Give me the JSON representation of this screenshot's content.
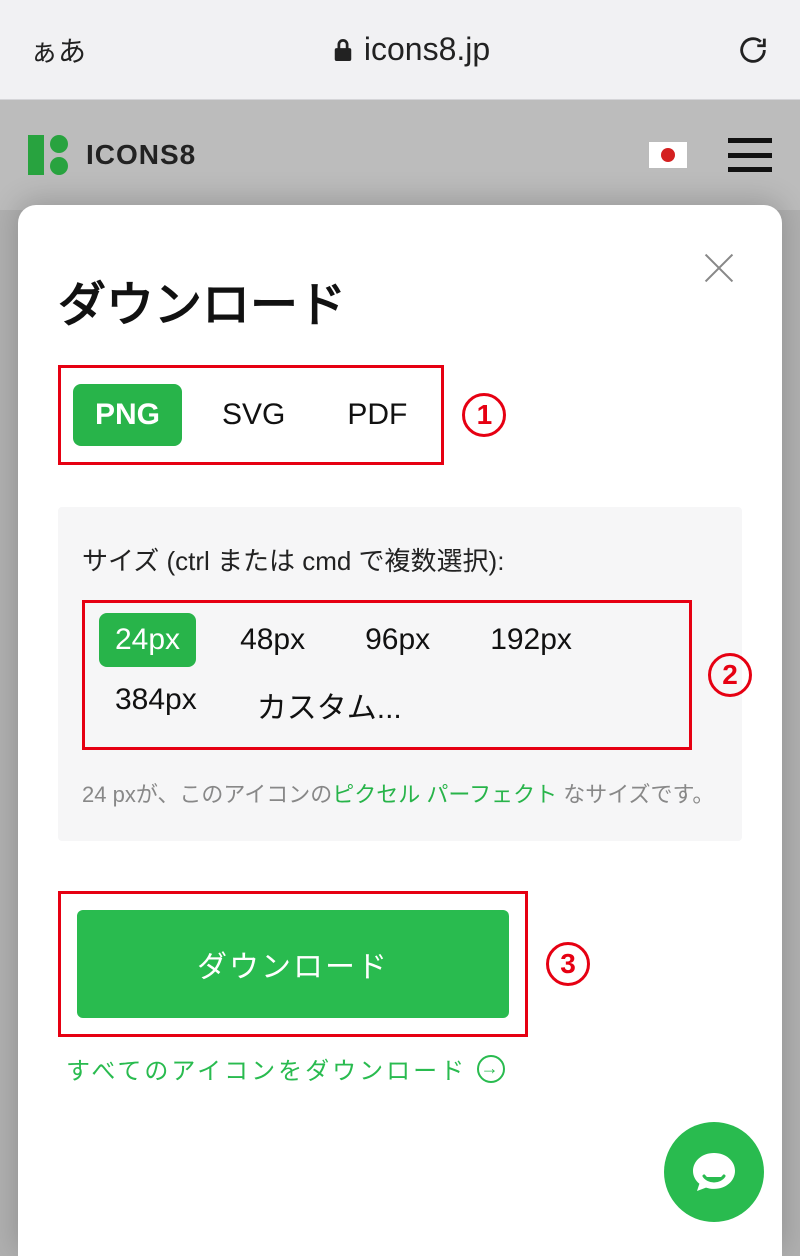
{
  "browser": {
    "aa": "ぁあ",
    "domain": "icons8.jp"
  },
  "header": {
    "logo_text": "ICONS8"
  },
  "modal": {
    "title": "ダウンロード",
    "formats": {
      "png": "PNG",
      "svg": "SVG",
      "pdf": "PDF"
    },
    "size_label": "サイズ (ctrl または cmd で複数選択):",
    "sizes": {
      "s24": "24px",
      "s48": "48px",
      "s96": "96px",
      "s192": "192px",
      "s384": "384px",
      "custom": "カスタム..."
    },
    "hint_pre": "24 pxが、このアイコンの",
    "hint_link": "ピクセル パーフェクト",
    "hint_post": " なサイズです。",
    "download_btn": "ダウンロード",
    "download_all": "すべてのアイコンをダウンロード"
  },
  "annotations": {
    "n1": "1",
    "n2": "2",
    "n3": "3"
  }
}
